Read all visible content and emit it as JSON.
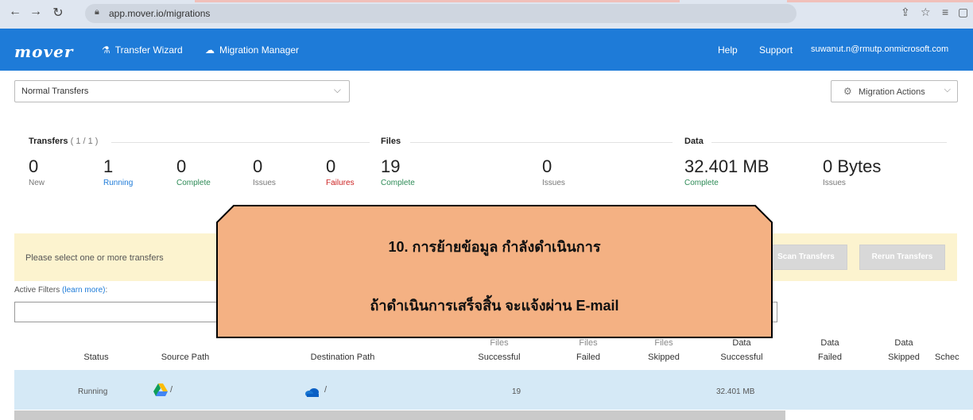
{
  "browser": {
    "url": "app.mover.io/migrations"
  },
  "appbar": {
    "logo": "mover",
    "nav": [
      {
        "label": "Transfer Wizard"
      },
      {
        "label": "Migration Manager"
      }
    ],
    "help": "Help",
    "support": "Support",
    "user": "suwanut.n@rmutp.onmicrosoft.com"
  },
  "toolbar": {
    "select_value": "Normal Transfers",
    "actions_label": "Migration Actions"
  },
  "stats": {
    "transfers_title": "Transfers",
    "transfers_count": "( 1 / 1 )",
    "files_title": "Files",
    "data_title": "Data",
    "items": [
      {
        "value": "0",
        "label": "New"
      },
      {
        "value": "1",
        "label": "Running"
      },
      {
        "value": "0",
        "label": "Complete"
      },
      {
        "value": "0",
        "label": "Issues"
      },
      {
        "value": "0",
        "label": "Failures"
      },
      {
        "value": "19",
        "label": "Complete"
      },
      {
        "value": "0",
        "label": "Issues"
      },
      {
        "value": "32.401 MB",
        "label": "Complete"
      },
      {
        "value": "0 Bytes",
        "label": "Issues"
      }
    ],
    "colors": {
      "running": "#1e7bd8",
      "complete": "#2e8b57",
      "issues": "#777777",
      "failures": "#cc2222"
    }
  },
  "banner": {
    "message": "Please select one or more transfers",
    "scan_button": "Scan Transfers",
    "rerun_button": "Rerun Transfers"
  },
  "filters": {
    "label": "Active Filters",
    "link": "(learn more)",
    "suffix": ":"
  },
  "table": {
    "headers": {
      "status": "Status",
      "source": "Source Path",
      "destination": "Destination Path",
      "files_successful_1": "Files",
      "files_successful_2": "Successful",
      "files_failed_1": "Files",
      "files_failed_2": "Failed",
      "files_skipped_1": "Files",
      "files_skipped_2": "Skipped",
      "data_successful_1": "Data",
      "data_successful_2": "Successful",
      "data_failed_1": "Data",
      "data_failed_2": "Failed",
      "data_skipped_1": "Data",
      "data_skipped_2": "Skipped",
      "schedule": "Schec"
    },
    "row": {
      "status": "Running",
      "source": "/",
      "destination": "/",
      "files_successful": "19",
      "data_successful": "32.401 MB"
    }
  },
  "callout": {
    "line1": "10. การย้ายข้อมูล กำลังดำเนินการ",
    "line2": "ถ้าดำเนินการเสร็จสิ้น จะแจ้งผ่าน E-mail",
    "fill": "#f4b183",
    "stroke": "#000000"
  }
}
